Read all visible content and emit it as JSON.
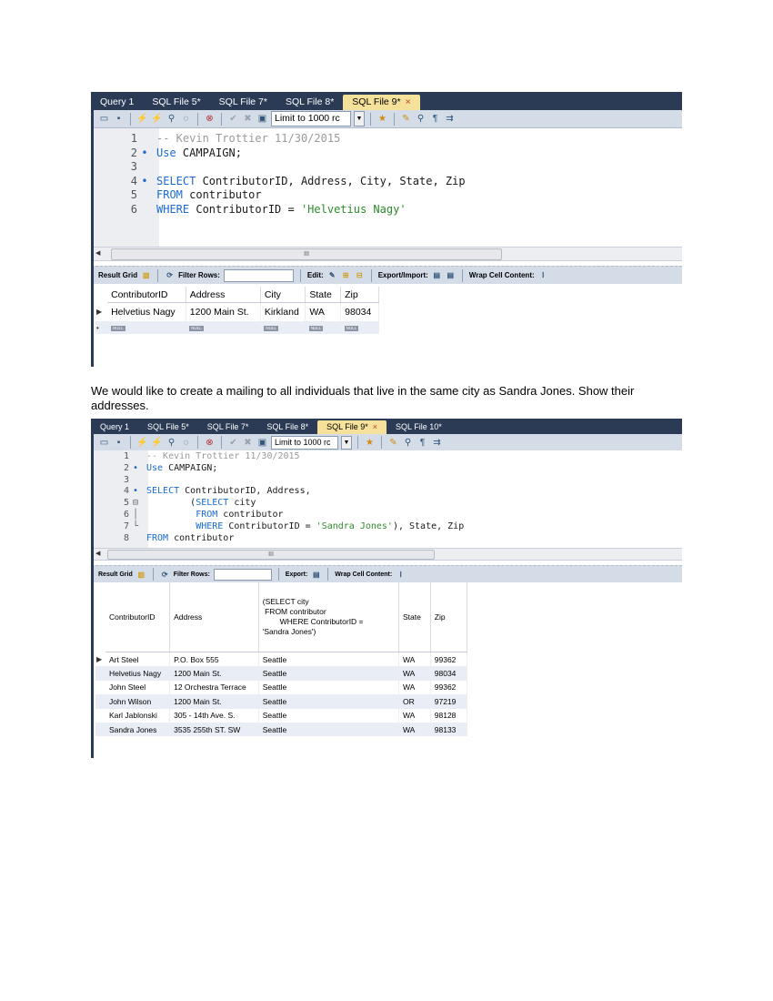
{
  "screenshot1": {
    "tabs": [
      {
        "label": "Query 1",
        "active": false,
        "close": false
      },
      {
        "label": "SQL File 5*",
        "active": false,
        "close": false
      },
      {
        "label": "SQL File 7*",
        "active": false,
        "close": false
      },
      {
        "label": "SQL File 8*",
        "active": false,
        "close": false
      },
      {
        "label": "SQL File 9*",
        "active": true,
        "close": true
      }
    ],
    "close_glyph": "×",
    "toolbar": {
      "limit_label": "Limit to 1000 rc"
    },
    "editor_lines": [
      {
        "num": "1",
        "marker": "",
        "parts": [
          {
            "t": "-- Kevin Trottier 11/30/2015",
            "c": "cm"
          }
        ]
      },
      {
        "num": "2",
        "marker": "•",
        "parts": [
          {
            "t": "Use",
            "c": "kw"
          },
          {
            "t": " CAMPAIGN;",
            "c": ""
          }
        ]
      },
      {
        "num": "3",
        "marker": "",
        "parts": []
      },
      {
        "num": "4",
        "marker": "•",
        "parts": [
          {
            "t": "SELECT",
            "c": "kw"
          },
          {
            "t": " ContributorID, Address, City, State, Zip",
            "c": ""
          }
        ]
      },
      {
        "num": "5",
        "marker": "",
        "parts": [
          {
            "t": "FROM",
            "c": "kw"
          },
          {
            "t": " contributor",
            "c": ""
          }
        ]
      },
      {
        "num": "6",
        "marker": "",
        "parts": [
          {
            "t": "WHERE",
            "c": "kw"
          },
          {
            "t": " ContributorID = ",
            "c": ""
          },
          {
            "t": "'Helvetius Nagy'",
            "c": "str"
          }
        ]
      }
    ],
    "scroll_thumb": "III",
    "result_bar": {
      "result_grid": "Result Grid",
      "filter_rows": "Filter Rows:",
      "edit": "Edit:",
      "export_import": "Export/Import:",
      "wrap_cell": "Wrap Cell Content:"
    },
    "grid": {
      "headers": [
        "ContributorID",
        "Address",
        "City",
        "State",
        "Zip"
      ],
      "rows": [
        [
          "Helvetius Nagy",
          "1200 Main St.",
          "Kirkland",
          "WA",
          "98034"
        ]
      ],
      "null_label": "NULL",
      "current_row_marker": "▶",
      "new_row_marker": "•"
    }
  },
  "paragraph": "We would like to create a mailing to all individuals that live in the same city as Sandra Jones. Show their addresses.",
  "screenshot2": {
    "tabs": [
      {
        "label": "Query 1",
        "active": false,
        "close": false
      },
      {
        "label": "SQL File 5*",
        "active": false,
        "close": false
      },
      {
        "label": "SQL File 7*",
        "active": false,
        "close": false
      },
      {
        "label": "SQL File 8*",
        "active": false,
        "close": false
      },
      {
        "label": "SQL File 9*",
        "active": true,
        "close": true
      },
      {
        "label": "SQL File 10*",
        "active": false,
        "close": false
      }
    ],
    "close_glyph": "×",
    "toolbar": {
      "limit_label": "Limit to 1000 rc"
    },
    "editor_lines": [
      {
        "num": "1",
        "marker": "",
        "parts": [
          {
            "t": "-- Kevin Trottier 11/30/2015",
            "c": "cm"
          }
        ]
      },
      {
        "num": "2",
        "marker": "•",
        "parts": [
          {
            "t": "Use",
            "c": "kw"
          },
          {
            "t": " CAMPAIGN;",
            "c": ""
          }
        ]
      },
      {
        "num": "3",
        "marker": "",
        "parts": []
      },
      {
        "num": "4",
        "marker": "•",
        "parts": [
          {
            "t": "SELECT",
            "c": "kw"
          },
          {
            "t": " ContributorID, Address,",
            "c": ""
          }
        ]
      },
      {
        "num": "5",
        "marker": "⊟",
        "parts": [
          {
            "t": "        (",
            "c": ""
          },
          {
            "t": "SELECT",
            "c": "kw"
          },
          {
            "t": " city",
            "c": ""
          }
        ]
      },
      {
        "num": "6",
        "marker": "│",
        "parts": [
          {
            "t": "         ",
            "c": ""
          },
          {
            "t": "FROM",
            "c": "kw"
          },
          {
            "t": " contributor",
            "c": ""
          }
        ]
      },
      {
        "num": "7",
        "marker": "└",
        "parts": [
          {
            "t": "         ",
            "c": ""
          },
          {
            "t": "WHERE",
            "c": "kw"
          },
          {
            "t": " ContributorID = ",
            "c": ""
          },
          {
            "t": "'Sandra Jones'",
            "c": "str"
          },
          {
            "t": "), State, Zip",
            "c": ""
          }
        ]
      },
      {
        "num": "8",
        "marker": "",
        "parts": [
          {
            "t": "FROM",
            "c": "kw"
          },
          {
            "t": " contributor",
            "c": ""
          }
        ]
      }
    ],
    "scroll_thumb": "III",
    "result_bar": {
      "result_grid": "Result Grid",
      "filter_rows": "Filter Rows:",
      "export": "Export:",
      "wrap_cell": "Wrap Cell Content:"
    },
    "grid": {
      "headers": [
        "ContributorID",
        "Address",
        "(SELECT city\n FROM contributor\n        WHERE ContributorID =\n'Sandra Jones')",
        "State",
        "Zip"
      ],
      "rows": [
        [
          "Art Steel",
          "P.O. Box 555",
          "Seattle",
          "WA",
          "99362"
        ],
        [
          "Helvetius Nagy",
          "1200 Main St.",
          "Seattle",
          "WA",
          "98034"
        ],
        [
          "John Steel",
          "12 Orchestra Terrace",
          "Seattle",
          "WA",
          "99362"
        ],
        [
          "John Wilson",
          "1200 Main St.",
          "Seattle",
          "OR",
          "97219"
        ],
        [
          "Karl Jablonski",
          "305 - 14th Ave. S.",
          "Seattle",
          "WA",
          "98128"
        ],
        [
          "Sandra Jones",
          "3535 255th ST. SW",
          "Seattle",
          "WA",
          "98133"
        ]
      ],
      "current_row_marker": "▶"
    }
  }
}
